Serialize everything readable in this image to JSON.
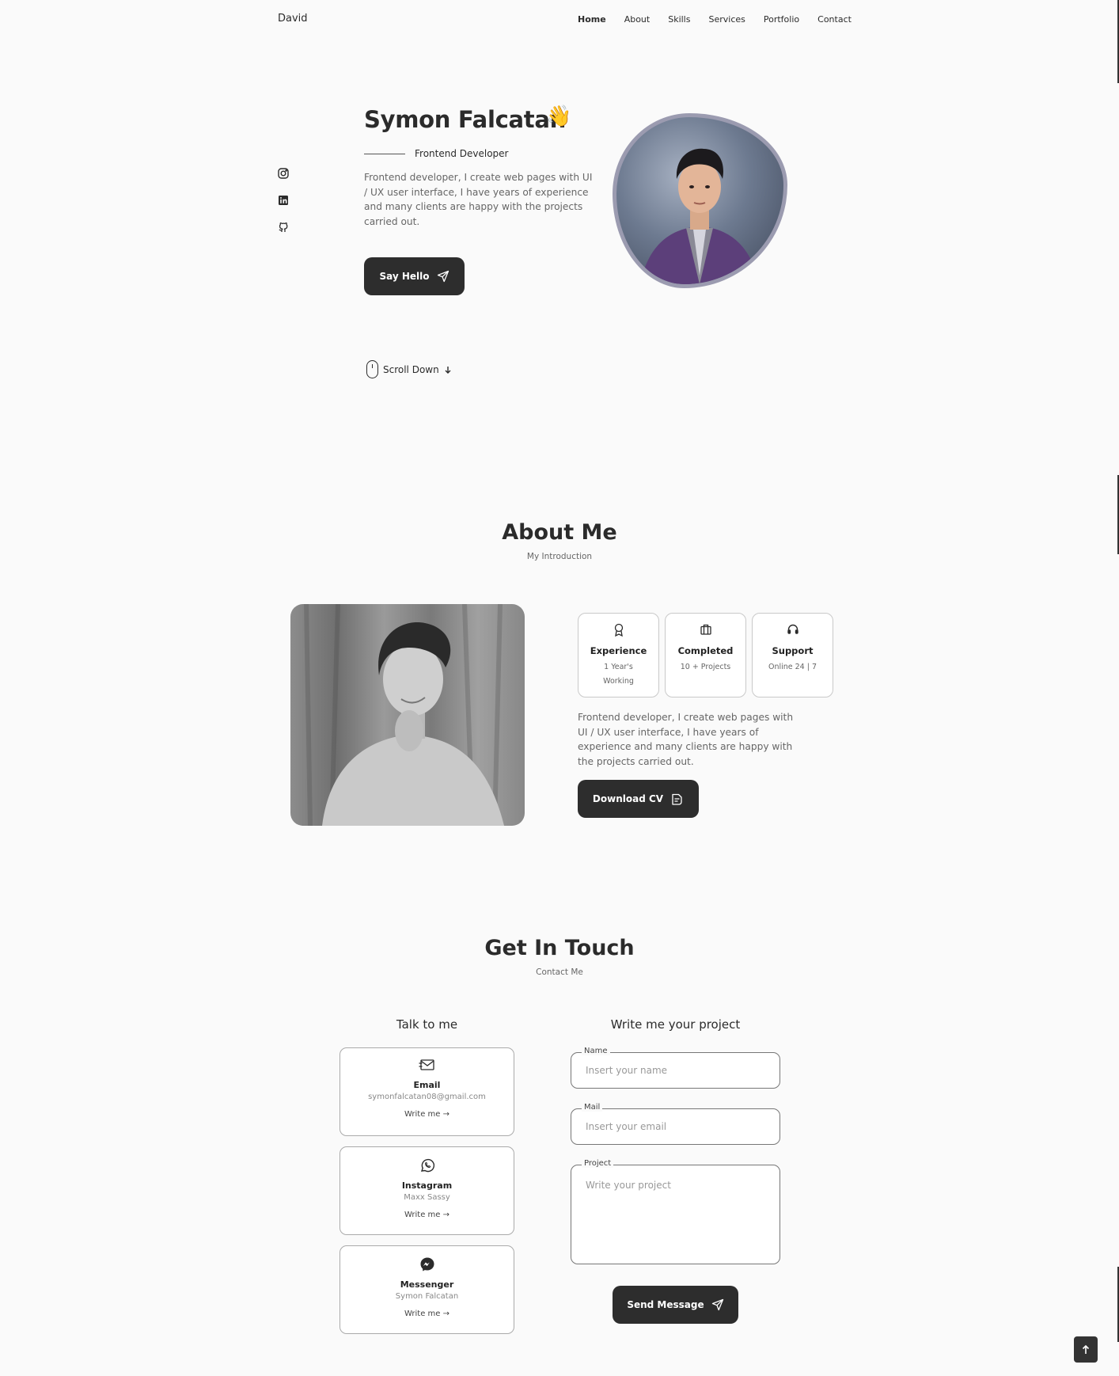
{
  "header": {
    "logo": "David",
    "nav": [
      "Home",
      "About",
      "Skills",
      "Services",
      "Portfolio",
      "Contact"
    ],
    "active": "Home"
  },
  "social": [
    "instagram-icon",
    "linkedin-icon",
    "github-icon"
  ],
  "hero": {
    "name": "Symon Falcatan",
    "wave": "👋",
    "subtitle": "Frontend Developer",
    "description": "Frontend developer, I create web pages with UI / UX user interface, I have years of experience and many clients are happy with the projects carried out.",
    "cta": "Say Hello",
    "scroll": "Scroll Down"
  },
  "about": {
    "title": "About Me",
    "subtitle": "My Introduction",
    "boxes": [
      {
        "icon": "award-icon",
        "title": "Experience",
        "sub": "1 Year's Working"
      },
      {
        "icon": "briefcase-icon",
        "title": "Completed",
        "sub": "10 + Projects"
      },
      {
        "icon": "headset-icon",
        "title": "Support",
        "sub": "Online 24 | 7"
      }
    ],
    "description": "Frontend developer, I create web pages with UI / UX user interface, I have years of experience and many clients are happy with the projects carried out.",
    "cta": "Download CV"
  },
  "contact": {
    "title": "Get In Touch",
    "subtitle": "Contact Me",
    "left_title": "Talk to me",
    "right_title": "Write me your project",
    "cards": [
      {
        "icon": "email-icon",
        "title": "Email",
        "sub": "symonfalcatan08@gmail.com",
        "link": "Write me"
      },
      {
        "icon": "whatsapp-icon",
        "title": "Instagram",
        "sub": "Maxx Sassy",
        "link": "Write me"
      },
      {
        "icon": "messenger-icon",
        "title": "Messenger",
        "sub": "Symon Falcatan",
        "link": "Write me"
      }
    ],
    "form": {
      "name_label": "Name",
      "name_placeholder": "Insert your name",
      "mail_label": "Mail",
      "mail_placeholder": "Insert your email",
      "project_label": "Project",
      "project_placeholder": "Write your project",
      "submit": "Send Message"
    }
  }
}
